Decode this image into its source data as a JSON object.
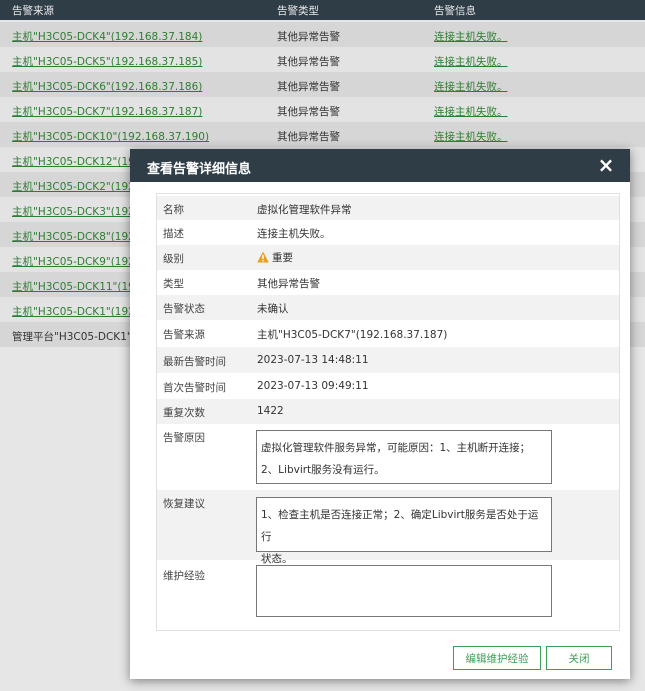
{
  "table": {
    "headers": [
      "告警来源",
      "告警类型",
      "告警信息"
    ],
    "rows": [
      {
        "source": "主机\"H3C05-DCK4\"(192.168.37.184)",
        "type": "其他异常告警",
        "info": "连接主机失败。",
        "link": true
      },
      {
        "source": "主机\"H3C05-DCK5\"(192.168.37.185)",
        "type": "其他异常告警",
        "info": "连接主机失败。",
        "link": true
      },
      {
        "source": "主机\"H3C05-DCK6\"(192.168.37.186)",
        "type": "其他异常告警",
        "info": "连接主机失败。",
        "link": true
      },
      {
        "source": "主机\"H3C05-DCK7\"(192.168.37.187)",
        "type": "其他异常告警",
        "info": "连接主机失败。",
        "link": true
      },
      {
        "source": "主机\"H3C05-DCK10\"(192.168.37.190)",
        "type": "其他异常告警",
        "info": "连接主机失败。",
        "link": true
      },
      {
        "source": "主机\"H3C05-DCK12\"(192.1",
        "type": "",
        "info": "",
        "link": true
      },
      {
        "source": "主机\"H3C05-DCK2\"(192.1",
        "type": "",
        "info": "",
        "link": true
      },
      {
        "source": "主机\"H3C05-DCK3\"(192.1",
        "type": "",
        "info": "",
        "link": true
      },
      {
        "source": "主机\"H3C05-DCK8\"(192.1",
        "type": "",
        "info": "",
        "link": true
      },
      {
        "source": "主机\"H3C05-DCK9\"(192.1",
        "type": "",
        "info": "",
        "link": true
      },
      {
        "source": "主机\"H3C05-DCK11\"(192.",
        "type": "",
        "info": "",
        "link": true
      },
      {
        "source": "主机\"H3C05-DCK1\"(192.1",
        "type": "",
        "info": "",
        "link": true
      },
      {
        "source": "管理平台\"H3C05-DCK1\"(1",
        "type": "",
        "info": "",
        "link": false
      }
    ]
  },
  "dialog": {
    "title": "查看告警详细信息",
    "close_icon": "×",
    "fields": [
      {
        "label": "名称",
        "value": "虚拟化管理软件异常"
      },
      {
        "label": "描述",
        "value": "连接主机失败。"
      },
      {
        "label": "级别",
        "value": "重要"
      },
      {
        "label": "类型",
        "value": "其他异常告警"
      },
      {
        "label": "告警状态",
        "value": "未确认"
      },
      {
        "label": "告警来源",
        "value": "主机\"H3C05-DCK7\"(192.168.37.187)"
      },
      {
        "label": "最新告警时间",
        "value": "2023-07-13 14:48:11"
      },
      {
        "label": "首次告警时间",
        "value": "2023-07-13 09:49:11"
      },
      {
        "label": "重复次数",
        "value": "1422"
      }
    ],
    "reason": {
      "label": "告警原因",
      "line1": "虚拟化管理软件服务异常，可能原因：1、主机断开连接；",
      "line2": "2、Libvirt服务没有运行。"
    },
    "suggestion": {
      "label": "恢复建议",
      "line1": "1、检查主机是否连接正常；2、确定Libvirt服务是否处于运行",
      "line2": "状态。"
    },
    "maintenance": {
      "label": "维护经验",
      "value": ""
    },
    "buttons": {
      "edit": "编辑维护经验",
      "close": "关闭"
    }
  }
}
